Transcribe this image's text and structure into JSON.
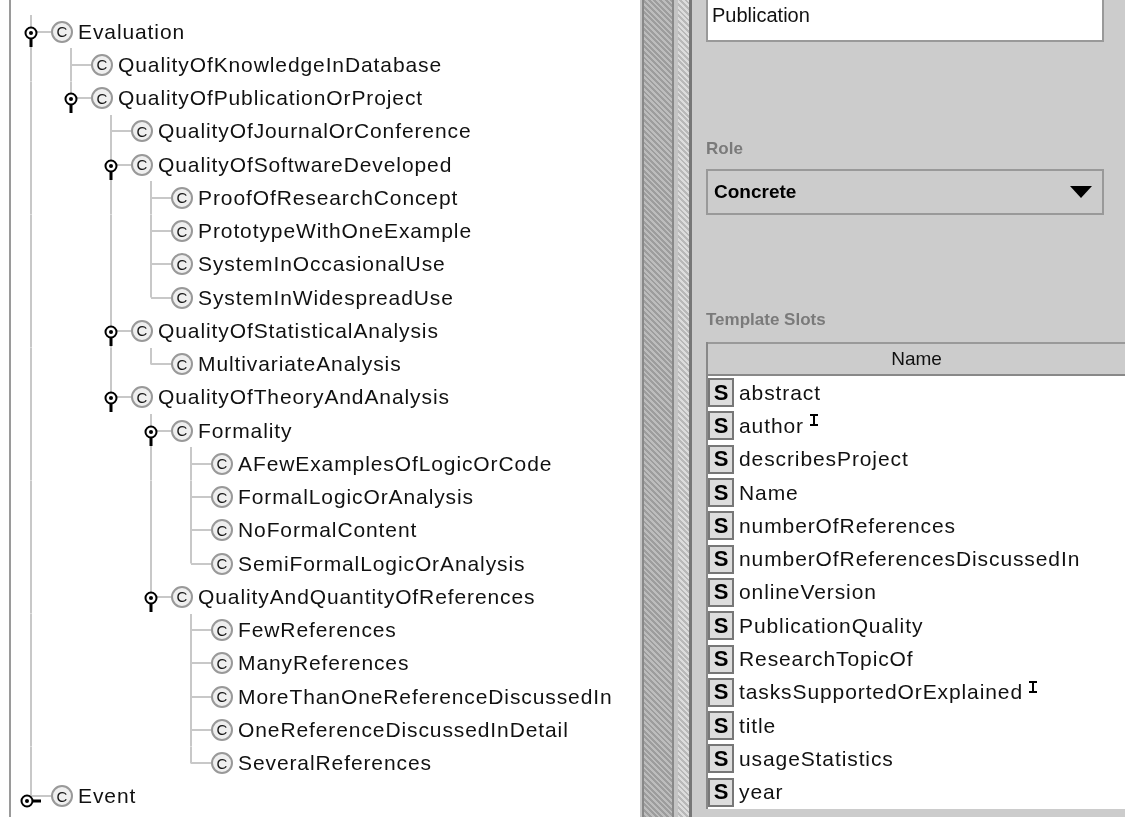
{
  "class_tree": [
    {
      "badge": "C",
      "label": "Evaluation",
      "expanded": true,
      "children": [
        {
          "badge": "C",
          "label": "QualityOfKnowledgeInDatabase"
        },
        {
          "badge": "C",
          "label": "QualityOfPublicationOrProject",
          "expanded": true,
          "children": [
            {
              "badge": "C",
              "label": "QualityOfJournalOrConference"
            },
            {
              "badge": "C",
              "label": "QualityOfSoftwareDeveloped",
              "expanded": true,
              "children": [
                {
                  "badge": "C",
                  "label": "ProofOfResearchConcept"
                },
                {
                  "badge": "C",
                  "label": "PrototypeWithOneExample"
                },
                {
                  "badge": "C",
                  "label": "SystemInOccasionalUse"
                },
                {
                  "badge": "C",
                  "label": "SystemInWidespreadUse"
                }
              ]
            },
            {
              "badge": "C",
              "label": "QualityOfStatisticalAnalysis",
              "expanded": true,
              "children": [
                {
                  "badge": "C",
                  "label": "MultivariateAnalysis"
                }
              ]
            },
            {
              "badge": "C",
              "label": "QualityOfTheoryAndAnalysis",
              "expanded": true,
              "children": [
                {
                  "badge": "C",
                  "label": "Formality",
                  "expanded": true,
                  "children": [
                    {
                      "badge": "C",
                      "label": "AFewExamplesOfLogicOrCode"
                    },
                    {
                      "badge": "C",
                      "label": "FormalLogicOrAnalysis"
                    },
                    {
                      "badge": "C",
                      "label": "NoFormalContent"
                    },
                    {
                      "badge": "C",
                      "label": "SemiFormalLogicOrAnalysis"
                    }
                  ]
                },
                {
                  "badge": "C",
                  "label": "QualityAndQuantityOfReferences",
                  "expanded": true,
                  "children": [
                    {
                      "badge": "C",
                      "label": "FewReferences"
                    },
                    {
                      "badge": "C",
                      "label": "ManyReferences"
                    },
                    {
                      "badge": "C",
                      "label": "MoreThanOneReferenceDiscussedIn"
                    },
                    {
                      "badge": "C",
                      "label": "OneReferenceDiscussedInDetail"
                    },
                    {
                      "badge": "C",
                      "label": "SeveralReferences"
                    }
                  ]
                }
              ]
            }
          ]
        }
      ]
    },
    {
      "badge": "C",
      "label": "Event",
      "expanded": false
    }
  ],
  "name_field": {
    "value": "Publication"
  },
  "role": {
    "label": "Role",
    "value": "Concrete"
  },
  "template_slots": {
    "label": "Template Slots",
    "column": "Name",
    "rows": [
      {
        "badge": "S",
        "name": "abstract",
        "marked": false
      },
      {
        "badge": "S",
        "name": "author",
        "marked": true
      },
      {
        "badge": "S",
        "name": "describesProject",
        "marked": false
      },
      {
        "badge": "S",
        "name": "Name",
        "marked": false
      },
      {
        "badge": "S",
        "name": "numberOfReferences",
        "marked": false
      },
      {
        "badge": "S",
        "name": "numberOfReferencesDiscussedIn",
        "marked": false
      },
      {
        "badge": "S",
        "name": "onlineVersion",
        "marked": false
      },
      {
        "badge": "S",
        "name": "PublicationQuality",
        "marked": false
      },
      {
        "badge": "S",
        "name": "ResearchTopicOf",
        "marked": false
      },
      {
        "badge": "S",
        "name": "tasksSupportedOrExplained",
        "marked": true
      },
      {
        "badge": "S",
        "name": "title",
        "marked": false
      },
      {
        "badge": "S",
        "name": "usageStatistics",
        "marked": false
      },
      {
        "badge": "S",
        "name": "year",
        "marked": false
      }
    ]
  }
}
